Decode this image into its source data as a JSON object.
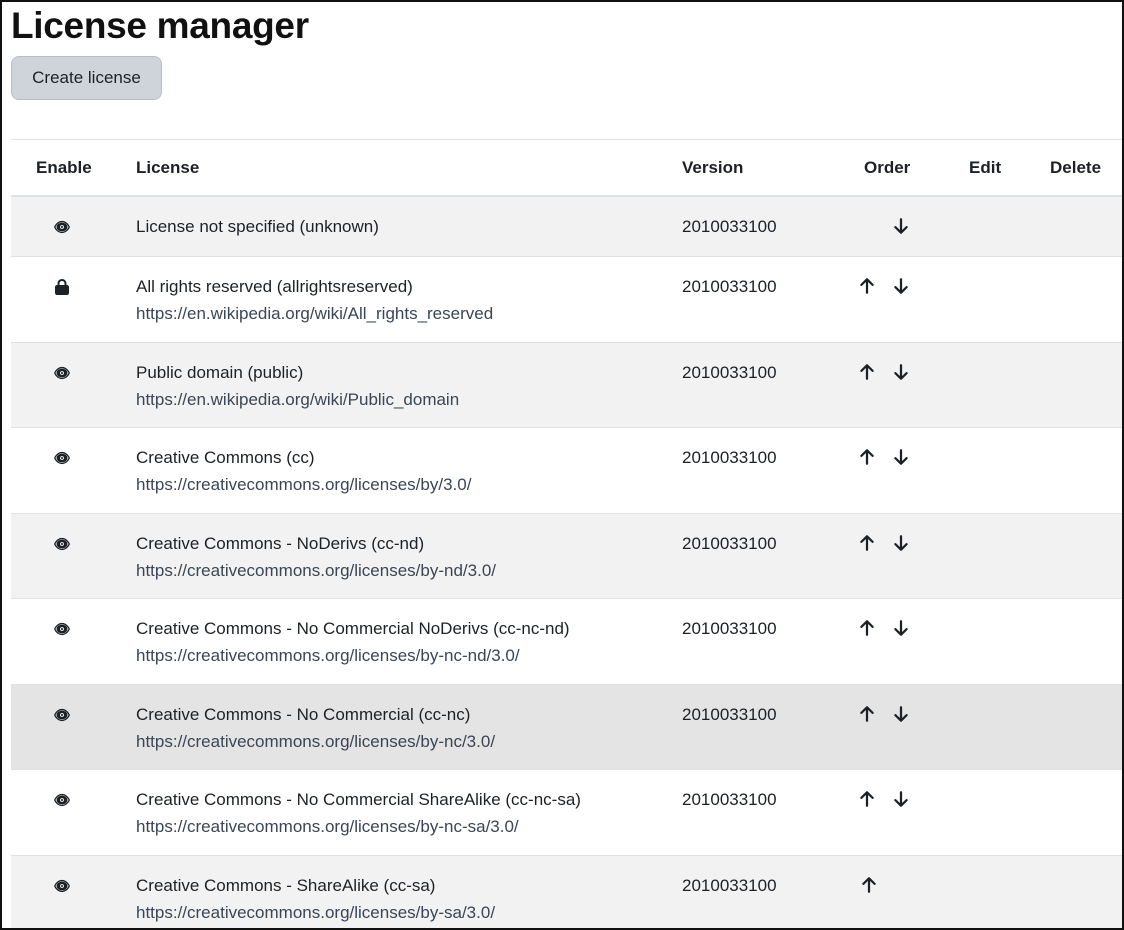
{
  "page": {
    "title": "License manager",
    "create_label": "Create license"
  },
  "table": {
    "headers": {
      "enable": "Enable",
      "license": "License",
      "version": "Version",
      "order": "Order",
      "edit": "Edit",
      "delete": "Delete"
    },
    "rows": [
      {
        "name": "License not specified (unknown)",
        "url": "",
        "version": "2010033100",
        "enable_icon": "eye-icon",
        "up": false,
        "down": true
      },
      {
        "name": "All rights reserved (allrightsreserved)",
        "url": "https://en.wikipedia.org/wiki/All_rights_reserved",
        "version": "2010033100",
        "enable_icon": "lock-icon",
        "up": true,
        "down": true
      },
      {
        "name": "Public domain (public)",
        "url": "https://en.wikipedia.org/wiki/Public_domain",
        "version": "2010033100",
        "enable_icon": "eye-icon",
        "up": true,
        "down": true
      },
      {
        "name": "Creative Commons (cc)",
        "url": "https://creativecommons.org/licenses/by/3.0/",
        "version": "2010033100",
        "enable_icon": "eye-icon",
        "up": true,
        "down": true
      },
      {
        "name": "Creative Commons - NoDerivs (cc-nd)",
        "url": "https://creativecommons.org/licenses/by-nd/3.0/",
        "version": "2010033100",
        "enable_icon": "eye-icon",
        "up": true,
        "down": true
      },
      {
        "name": "Creative Commons - No Commercial NoDerivs (cc-nc-nd)",
        "url": "https://creativecommons.org/licenses/by-nc-nd/3.0/",
        "version": "2010033100",
        "enable_icon": "eye-icon",
        "up": true,
        "down": true
      },
      {
        "name": "Creative Commons - No Commercial (cc-nc)",
        "url": "https://creativecommons.org/licenses/by-nc/3.0/",
        "version": "2010033100",
        "enable_icon": "eye-icon",
        "up": true,
        "down": true
      },
      {
        "name": "Creative Commons - No Commercial ShareAlike (cc-nc-sa)",
        "url": "https://creativecommons.org/licenses/by-nc-sa/3.0/",
        "version": "2010033100",
        "enable_icon": "eye-icon",
        "up": true,
        "down": true
      },
      {
        "name": "Creative Commons - ShareAlike (cc-sa)",
        "url": "https://creativecommons.org/licenses/by-sa/3.0/",
        "version": "2010033100",
        "enable_icon": "eye-icon",
        "up": true,
        "down": false
      }
    ]
  },
  "colors": {
    "stripe": "#f2f2f2",
    "hover": "#e4e4e4",
    "button": "#ced4da",
    "text": "#1d2125"
  }
}
